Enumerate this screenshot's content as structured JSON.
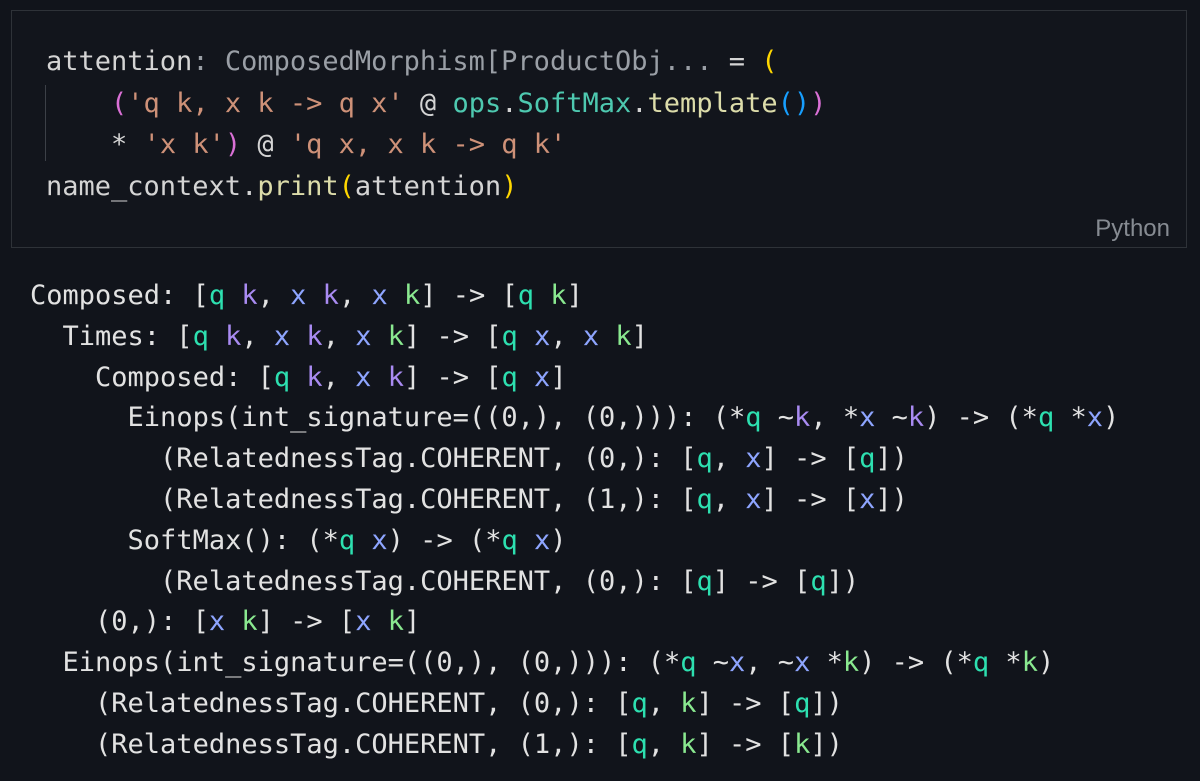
{
  "code_cell": {
    "line1": {
      "var": "attention",
      "colon": ":",
      "annotation": " ComposedMorphism[ProductObj...",
      "eq": " =",
      "paren": "("
    },
    "line2": {
      "open": "(",
      "str": "'q k, x k -> q x'",
      "at": "@",
      "mod": "ops",
      "cls": "SoftMax",
      "fn": "template",
      "call": "()",
      "close": ")"
    },
    "line3": {
      "op": "*",
      "str": "'x k'",
      "close": ")",
      "at": "@",
      "str2": "'q x, x k -> q k'"
    },
    "line4": {
      "obj": "name_context",
      "fn": "print",
      "open": "(",
      "arg": "attention",
      "close": ")"
    },
    "language": "Python"
  },
  "output": {
    "r1": {
      "kw": "Composed",
      "sig": ": ["
    },
    "r2": {
      "kw": "Times",
      "sig": ": ["
    },
    "r3": {
      "kw": "Composed",
      "sig": ": ["
    },
    "r4": {
      "kw": "Einops(int_signature=((0,), (0,))): (*"
    },
    "tag": "(RelatednessTag.COHERENT, ",
    "softmax": "SoftMax(): (*",
    "zero": "(0,)",
    "one": "(1,)"
  }
}
